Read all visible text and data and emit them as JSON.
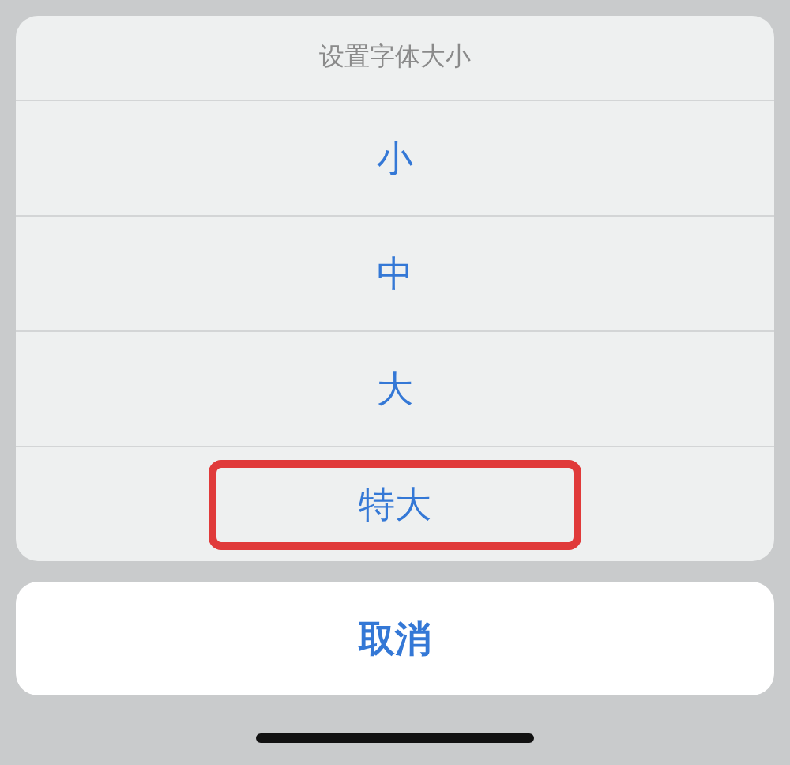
{
  "action_sheet": {
    "title": "设置字体大小",
    "options": [
      {
        "label": "小",
        "highlighted": false
      },
      {
        "label": "中",
        "highlighted": false
      },
      {
        "label": "大",
        "highlighted": false
      },
      {
        "label": "特大",
        "highlighted": true
      }
    ],
    "cancel": "取消"
  }
}
